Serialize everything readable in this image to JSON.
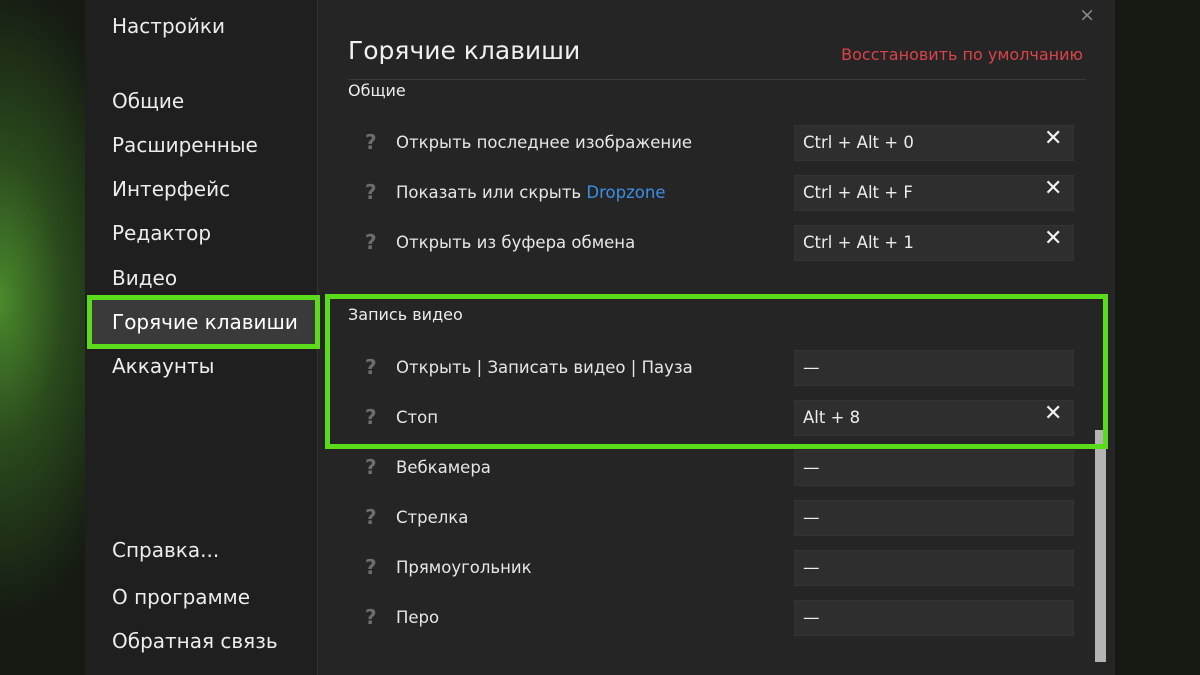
{
  "sidebar": {
    "title": "Настройки",
    "items": [
      {
        "label": "Общие"
      },
      {
        "label": "Расширенные"
      },
      {
        "label": "Интерфейс"
      },
      {
        "label": "Редактор"
      },
      {
        "label": "Видео"
      },
      {
        "label": "Горячие клавиши"
      },
      {
        "label": "Аккаунты"
      }
    ],
    "bottom": [
      {
        "label": "Справка..."
      },
      {
        "label": "О программе"
      },
      {
        "label": "Обратная связь"
      }
    ]
  },
  "main": {
    "title": "Горячие клавиши",
    "reset_label": "Восстановить по умолчанию",
    "close_glyph": "×",
    "clear_glyph": "✕",
    "help_glyph": "?",
    "sections": [
      {
        "title": "Общие",
        "rows": [
          {
            "label": "Открыть последнее изображение",
            "value": "Ctrl + Alt + 0"
          },
          {
            "label_prefix": "Показать или скрыть ",
            "label_brand": "Dropzone",
            "value": "Ctrl + Alt + F"
          },
          {
            "label": "Открыть из буфера обмена",
            "value": "Ctrl + Alt + 1"
          }
        ]
      },
      {
        "title": "Запись видео",
        "rows": [
          {
            "label": "Открыть | Записать видео | Пауза",
            "value": "—"
          },
          {
            "label": "Стоп",
            "value": "Alt + 8"
          },
          {
            "label": "Вебкамера",
            "value": "—"
          },
          {
            "label": "Стрелка",
            "value": "—"
          },
          {
            "label": "Прямоугольник",
            "value": "—"
          },
          {
            "label": "Перо",
            "value": "—"
          }
        ]
      }
    ]
  },
  "colors": {
    "highlight": "#5bdc1b",
    "reset_link": "#d9434a",
    "brand_link": "#3b8fe6"
  }
}
